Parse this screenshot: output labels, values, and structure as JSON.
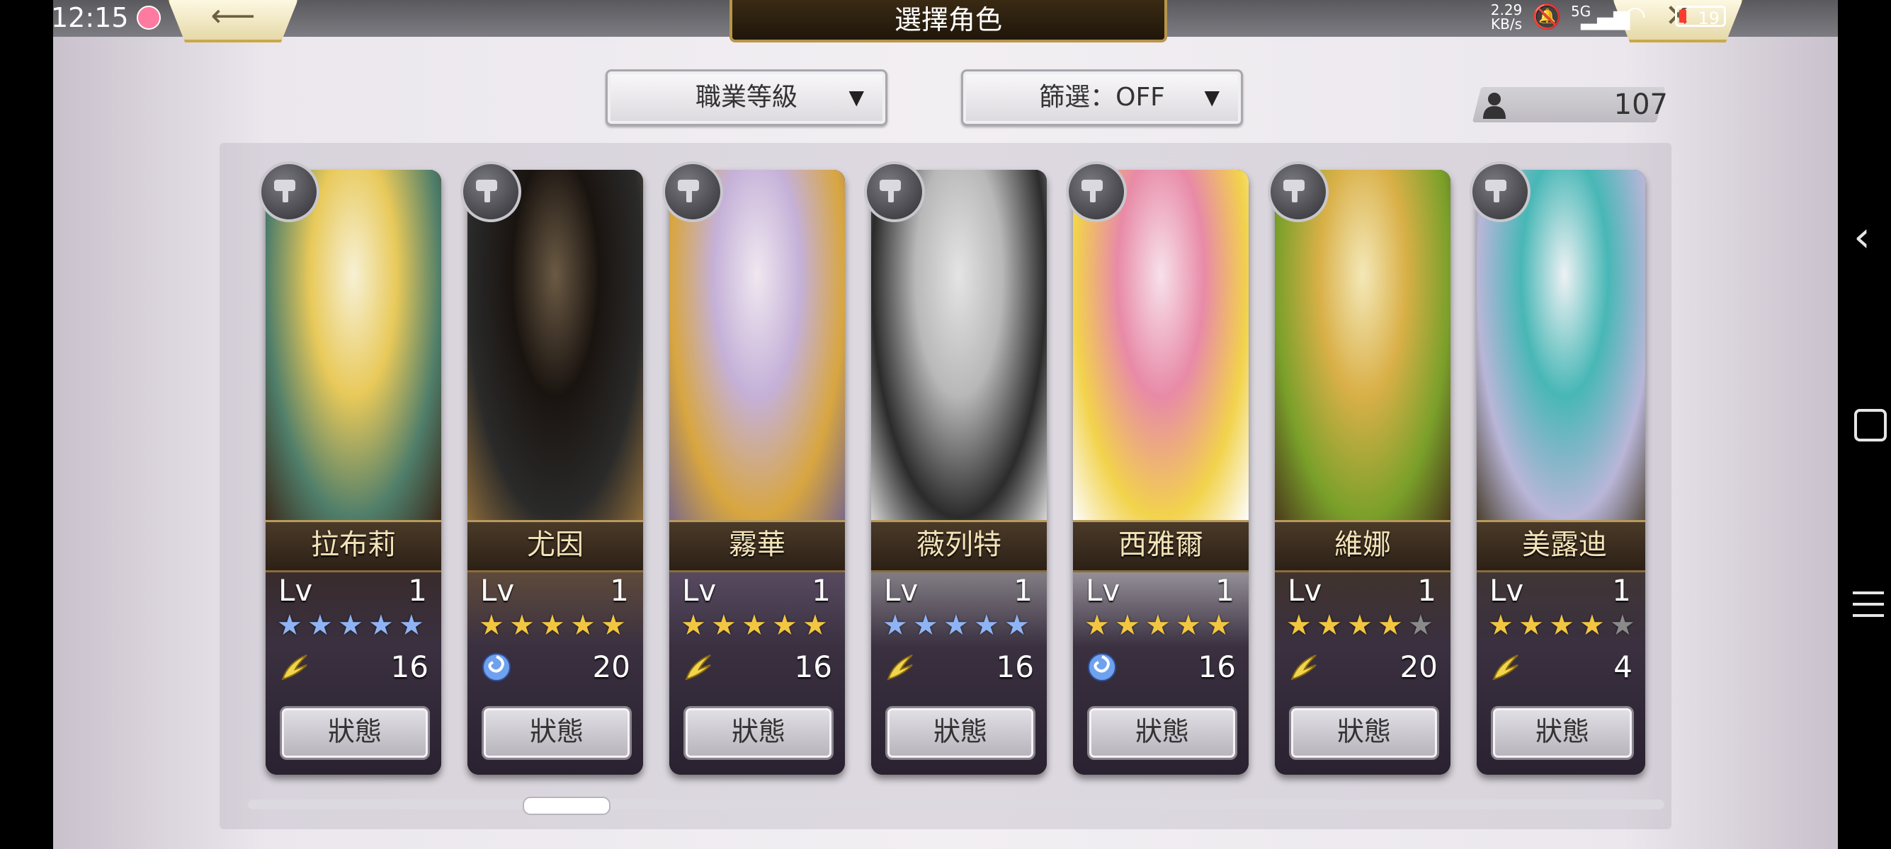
{
  "status_bar": {
    "time": "12:15",
    "net_speed_top": "2.29",
    "net_speed_bottom": "KB/s",
    "network": "5G",
    "wifi_level": "6",
    "battery": "19"
  },
  "header": {
    "title": "選擇角色",
    "back_icon": "back-arrow-icon",
    "close_icon": "close-x-icon"
  },
  "filters": {
    "sort_label": "職業等級",
    "filter_label": "篩選：OFF",
    "count": "107"
  },
  "colors": {
    "star_gold": "#f2c641",
    "star_blue": "#8fb4f5",
    "star_empty": "#8a8a8a",
    "name_text": "#f3e3b8",
    "plate_border": "#b99a5c"
  },
  "characters": [
    {
      "name": "拉布莉",
      "lv_label": "Lv",
      "lv": "1",
      "stars": 5,
      "star_color": "blue",
      "element": "wind-icon",
      "cost": "16",
      "button": "狀態",
      "class_icon": "fist-icon",
      "theme": "yellow"
    },
    {
      "name": "尤因",
      "lv_label": "Lv",
      "lv": "1",
      "stars": 5,
      "star_color": "gold",
      "element": "water-spiral-icon",
      "cost": "20",
      "button": "狀態",
      "class_icon": "hammer-icon",
      "theme": "dark"
    },
    {
      "name": "霧華",
      "lv_label": "Lv",
      "lv": "1",
      "stars": 5,
      "star_color": "gold",
      "element": "wind-icon",
      "cost": "16",
      "button": "狀態",
      "class_icon": "hammer-icon",
      "theme": "lilac"
    },
    {
      "name": "薇列特",
      "lv_label": "Lv",
      "lv": "1",
      "stars": 5,
      "star_color": "blue",
      "element": "wind-icon",
      "cost": "16",
      "button": "狀態",
      "class_icon": "hammer-icon",
      "theme": "gray"
    },
    {
      "name": "西雅爾",
      "lv_label": "Lv",
      "lv": "1",
      "stars": 5,
      "star_color": "gold",
      "element": "water-spiral-icon",
      "cost": "16",
      "button": "狀態",
      "class_icon": "hammer-icon",
      "theme": "pink"
    },
    {
      "name": "維娜",
      "lv_label": "Lv",
      "lv": "1",
      "stars": 4,
      "star_color": "gold",
      "element": "wind-icon",
      "cost": "20",
      "button": "狀態",
      "class_icon": "staff-icon",
      "theme": "gold"
    },
    {
      "name": "美露迪",
      "lv_label": "Lv",
      "lv": "1",
      "stars": 4,
      "star_color": "gold",
      "element": "wind-icon",
      "cost": "4",
      "button": "狀態",
      "class_icon": "staff-icon",
      "theme": "teal"
    }
  ],
  "scrollbar": {
    "position": 0.2
  }
}
